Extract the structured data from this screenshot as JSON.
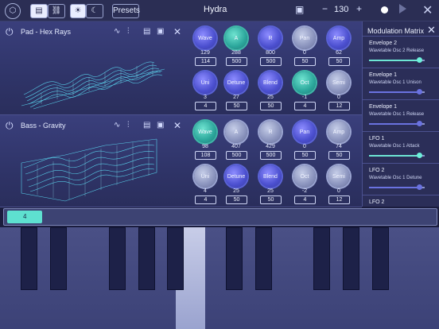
{
  "topbar": {
    "title": "Hydra",
    "presets_label": "Presets",
    "bpm": "130",
    "minus": "−",
    "plus": "+",
    "close": "✕"
  },
  "patches": [
    {
      "name": "Pad - Hex Rays",
      "knobs_row1": [
        {
          "label": "Wave",
          "value": "129",
          "box": "114",
          "style": "blue"
        },
        {
          "label": "A",
          "value": "288",
          "box": "500",
          "style": "teal"
        },
        {
          "label": "R",
          "value": "800",
          "box": "500",
          "style": "blue"
        },
        {
          "label": "Pan",
          "value": "0",
          "box": "50",
          "style": "gray"
        },
        {
          "label": "Amp",
          "value": "62",
          "box": "50",
          "style": "blue"
        }
      ],
      "knobs_row2": [
        {
          "label": "Uni",
          "value": "3",
          "box": "4",
          "style": "blue"
        },
        {
          "label": "Detune",
          "value": "27",
          "box": "50",
          "style": "blue"
        },
        {
          "label": "Blend",
          "value": "25",
          "box": "50",
          "style": "blue"
        },
        {
          "label": "Oct",
          "value": "-1",
          "box": "4",
          "style": "teal"
        },
        {
          "label": "Semi",
          "value": "0",
          "box": "12",
          "style": "gray"
        }
      ]
    },
    {
      "name": "Bass - Gravity",
      "knobs_row1": [
        {
          "label": "Wave",
          "value": "98",
          "box": "108",
          "style": "teal"
        },
        {
          "label": "A",
          "value": "407",
          "box": "500",
          "style": "gray"
        },
        {
          "label": "R",
          "value": "429",
          "box": "500",
          "style": "gray"
        },
        {
          "label": "Pan",
          "value": "0",
          "box": "50",
          "style": "blue"
        },
        {
          "label": "Amp",
          "value": "74",
          "box": "50",
          "style": "gray"
        }
      ],
      "knobs_row2": [
        {
          "label": "Uni",
          "value": "4",
          "box": "4",
          "style": "gray"
        },
        {
          "label": "Detune",
          "value": "25",
          "box": "50",
          "style": "blue"
        },
        {
          "label": "Blend",
          "value": "25",
          "box": "50",
          "style": "blue"
        },
        {
          "label": "Oct",
          "value": "-2",
          "box": "4",
          "style": "gray"
        },
        {
          "label": "Semi",
          "value": "0",
          "box": "12",
          "style": "gray"
        }
      ]
    }
  ],
  "modulation": {
    "title": "Modulation Matrix",
    "close": "✕",
    "items": [
      {
        "source": "Envelope 2",
        "target": "Wavetable Osc 2 Release",
        "amount": 0.9
      },
      {
        "source": "Envelope 1",
        "target": "Wavetable Osc 1 Unison",
        "amount": 0.9
      },
      {
        "source": "Envelope 1",
        "target": "Wavetable Osc 1 Release",
        "amount": 0.9
      },
      {
        "source": "LFO 1",
        "target": "Wavetable Osc 1 Attack",
        "amount": 0.9
      },
      {
        "source": "LFO 2",
        "target": "Wavetable Osc 1 Detune",
        "amount": 0.9
      },
      {
        "source": "LFO 2",
        "target": "",
        "amount": 0.9
      }
    ]
  },
  "keyboard": {
    "octave_label": "4",
    "active_white_key": 6,
    "colors": {
      "accent": "#5ee0d0",
      "knob_blue": "#4b4fcf",
      "knob_teal": "#2ba69b"
    }
  }
}
